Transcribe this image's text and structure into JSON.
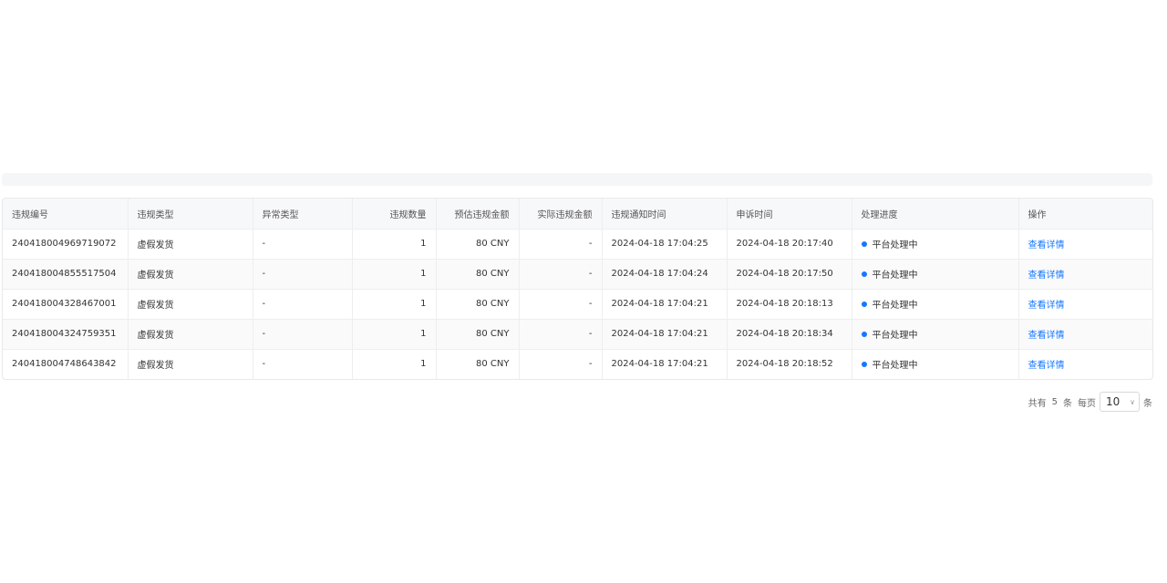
{
  "columns": [
    "违规编号",
    "违规类型",
    "异常类型",
    "违规数量",
    "预估违规金额",
    "实际违规金额",
    "违规通知时间",
    "申诉时间",
    "处理进度",
    "操作"
  ],
  "rows": [
    {
      "id": "240418004969719072",
      "type": "虚假发货",
      "abnormal": "-",
      "count": "1",
      "est": "80 CNY",
      "actual": "-",
      "notice": "2024-04-18 17:04:25",
      "appeal": "2024-04-18 20:17:40",
      "status": "平台处理中",
      "action": "查看详情"
    },
    {
      "id": "240418004855517504",
      "type": "虚假发货",
      "abnormal": "-",
      "count": "1",
      "est": "80 CNY",
      "actual": "-",
      "notice": "2024-04-18 17:04:24",
      "appeal": "2024-04-18 20:17:50",
      "status": "平台处理中",
      "action": "查看详情"
    },
    {
      "id": "240418004328467001",
      "type": "虚假发货",
      "abnormal": "-",
      "count": "1",
      "est": "80 CNY",
      "actual": "-",
      "notice": "2024-04-18 17:04:21",
      "appeal": "2024-04-18 20:18:13",
      "status": "平台处理中",
      "action": "查看详情"
    },
    {
      "id": "240418004324759351",
      "type": "虚假发货",
      "abnormal": "-",
      "count": "1",
      "est": "80 CNY",
      "actual": "-",
      "notice": "2024-04-18 17:04:21",
      "appeal": "2024-04-18 20:18:34",
      "status": "平台处理中",
      "action": "查看详情"
    },
    {
      "id": "240418004748643842",
      "type": "虚假发货",
      "abnormal": "-",
      "count": "1",
      "est": "80 CNY",
      "actual": "-",
      "notice": "2024-04-18 17:04:21",
      "appeal": "2024-04-18 20:18:52",
      "status": "平台处理中",
      "action": "查看详情"
    }
  ],
  "pagination": {
    "total_prefix": "共有",
    "total": "5",
    "total_suffix": "条",
    "per_page_label": "每页",
    "page_size": "10",
    "page_size_suffix": "条"
  },
  "colors": {
    "accent": "#1677ff",
    "header_bg": "#f7f8fa",
    "border": "#e8e9eb"
  },
  "icons": {
    "status_dot": "status-dot-icon",
    "select_arrow": "chevron-down-icon"
  }
}
